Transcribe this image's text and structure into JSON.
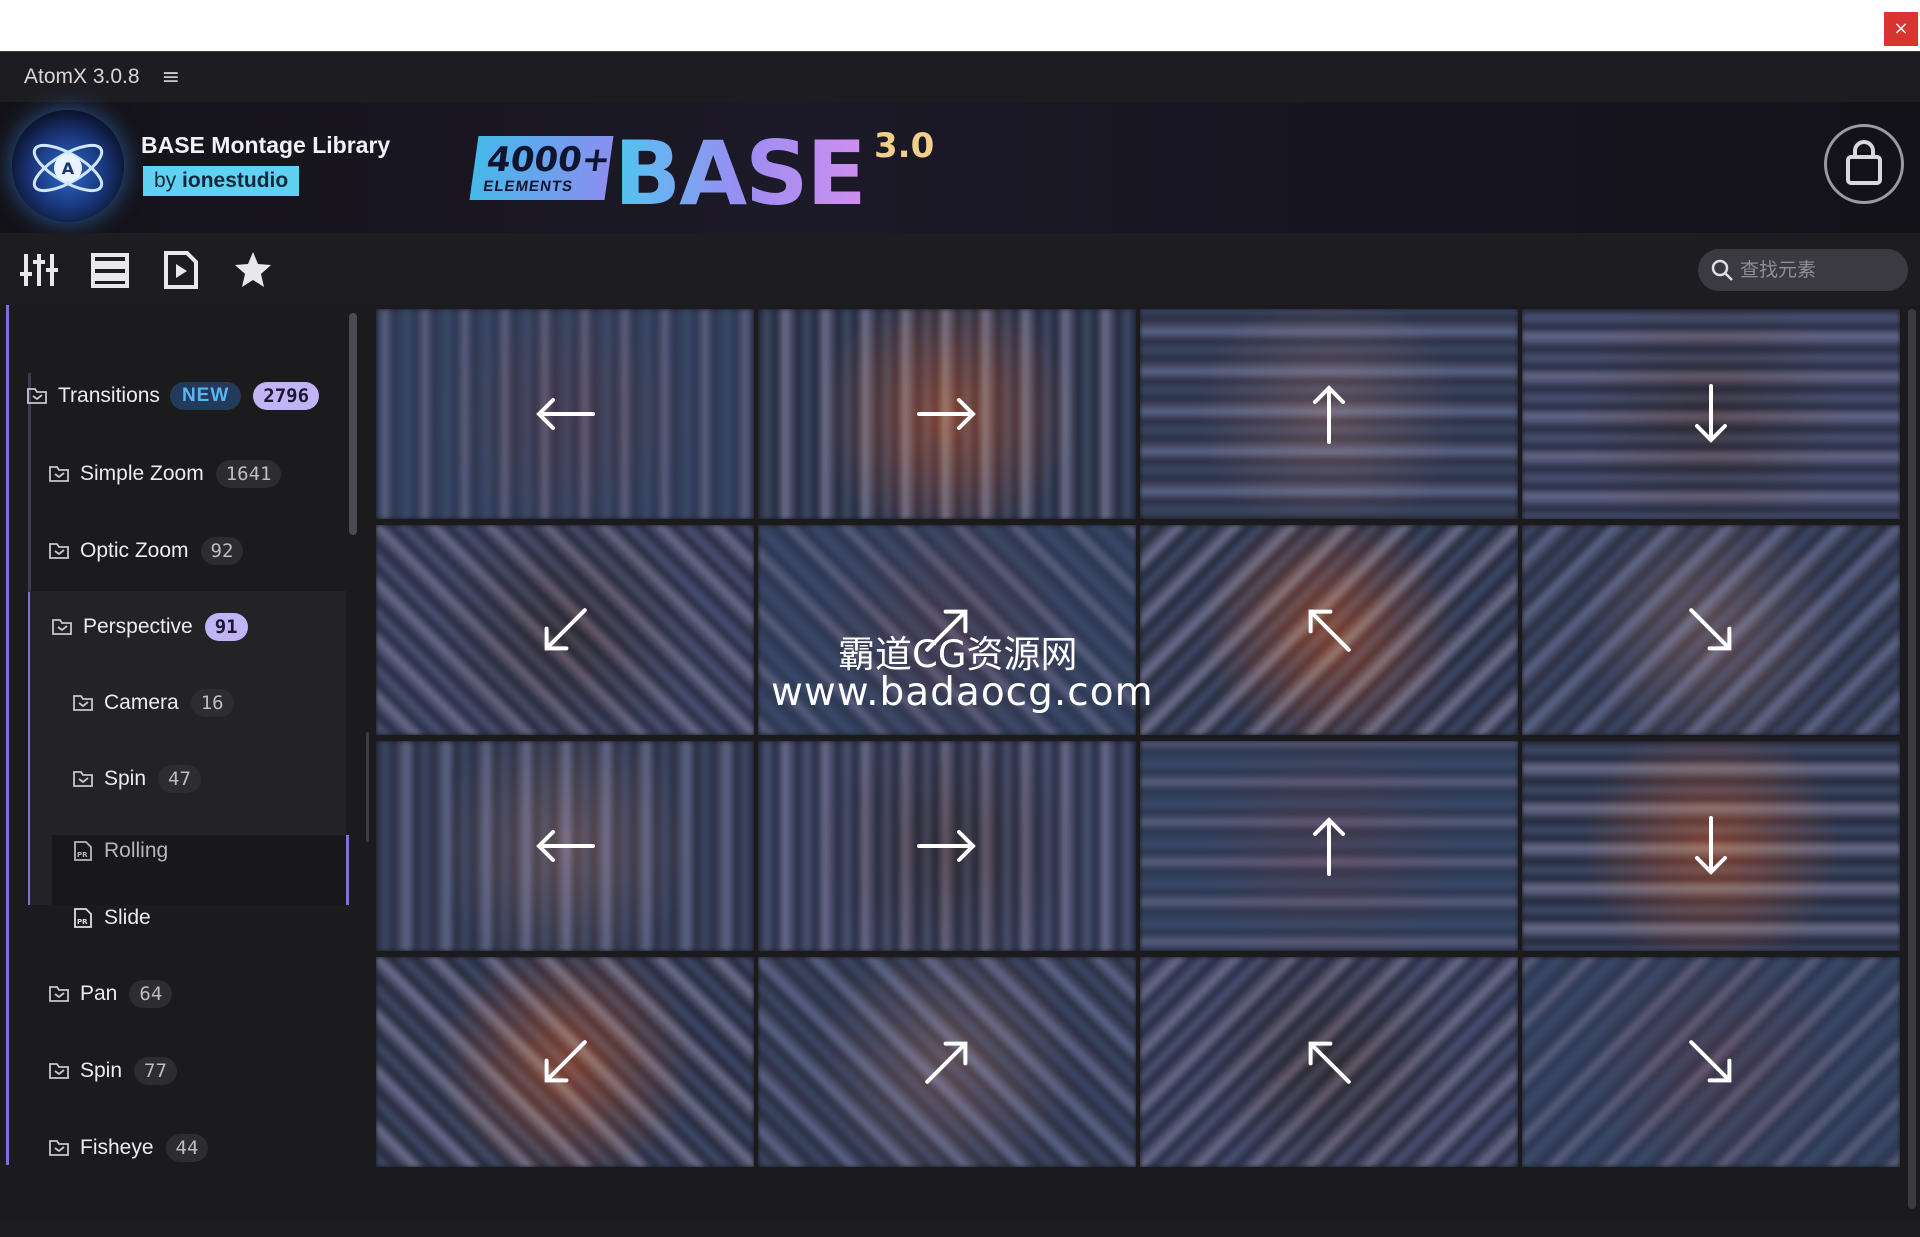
{
  "window": {
    "close_glyph": "×"
  },
  "titlebar": {
    "app_title": "AtomX 3.0.8",
    "menu_glyph": "≡"
  },
  "banner": {
    "library_title": "BASE Montage Library",
    "by_prefix": "by",
    "author": "ionestudio",
    "promo_count": "4000+",
    "promo_elements": "ELEMENTS",
    "promo_word": "BASE",
    "promo_version": "3.0",
    "accent_color": "#5fd1f2"
  },
  "toolbar": {
    "icons": [
      "sliders-icon",
      "list-view-icon",
      "preview-play-icon",
      "favorites-star-icon"
    ],
    "search_placeholder": "查找元素"
  },
  "sidebar": {
    "accent_color": "#7f6fd8",
    "items": [
      {
        "label": "Transitions",
        "badge": "NEW",
        "count": "2796",
        "icon": "folder-icon"
      },
      {
        "label": "Simple Zoom",
        "count": "1641",
        "icon": "folder-icon"
      },
      {
        "label": "Optic Zoom",
        "count": "92",
        "icon": "folder-icon"
      },
      {
        "label": "Perspective",
        "count": "91",
        "icon": "folder-icon"
      },
      {
        "label": "Camera",
        "count": "16",
        "icon": "folder-icon"
      },
      {
        "label": "Spin",
        "count": "47",
        "icon": "folder-icon"
      },
      {
        "label": "Rolling",
        "icon": "premiere-file-icon"
      },
      {
        "label": "Slide",
        "icon": "premiere-file-icon",
        "selected": true
      },
      {
        "label": "Pan",
        "count": "64",
        "icon": "folder-icon"
      },
      {
        "label": "Spin",
        "count": "77",
        "icon": "folder-icon"
      },
      {
        "label": "Fisheye",
        "count": "44",
        "icon": "folder-icon"
      }
    ]
  },
  "grid": {
    "thumbnails": [
      {
        "arrow": "left"
      },
      {
        "arrow": "right"
      },
      {
        "arrow": "up"
      },
      {
        "arrow": "down"
      },
      {
        "arrow": "down-left"
      },
      {
        "arrow": "up-right"
      },
      {
        "arrow": "up-left"
      },
      {
        "arrow": "down-right"
      },
      {
        "arrow": "left"
      },
      {
        "arrow": "right"
      },
      {
        "arrow": "up"
      },
      {
        "arrow": "down"
      },
      {
        "arrow": "down-left"
      },
      {
        "arrow": "up-right"
      },
      {
        "arrow": "up-left"
      },
      {
        "arrow": "down-right"
      }
    ]
  },
  "watermark": {
    "line1": "霸道CG资源网",
    "line2": "www.badaocg.com"
  },
  "bottombar": {
    "left_icons": [
      "target-icon",
      "video-clip-icon",
      "music-note-icon",
      "toggle-icon"
    ],
    "right_icons": [
      "lock-icon",
      "fit-frame-icon",
      "fullscreen-icon"
    ]
  }
}
